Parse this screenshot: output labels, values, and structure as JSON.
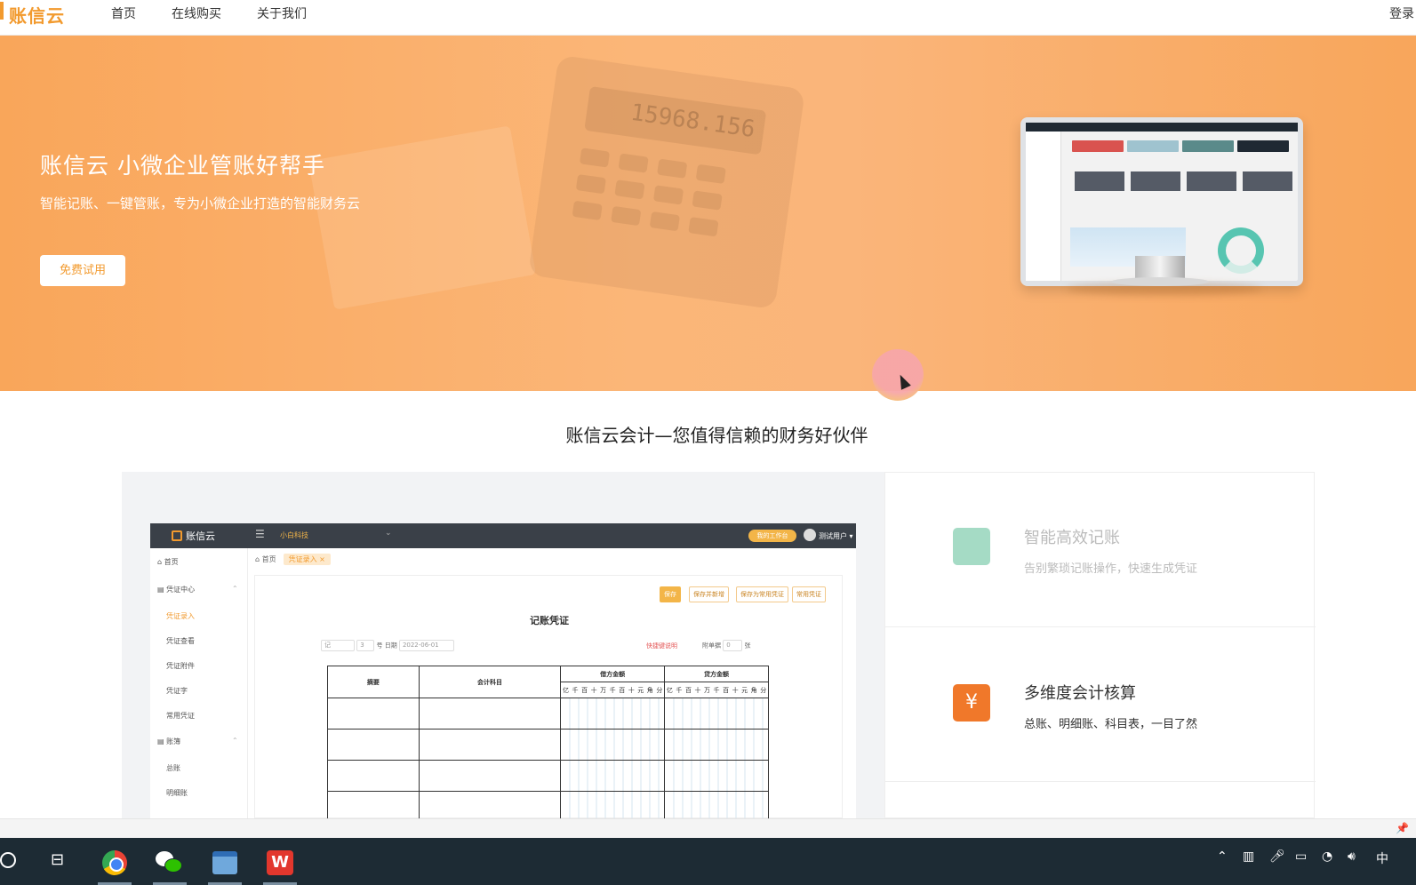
{
  "nav": {
    "logo": "账信云",
    "links": [
      "首页",
      "在线购买",
      "关于我们"
    ],
    "login": "登录"
  },
  "hero": {
    "title": "账信云 小微企业管账好帮手",
    "subtitle": "智能记账、一键管账，专为小微企业打造的智能财务云",
    "button": "免费试用",
    "calculator_display": "15968.156"
  },
  "section": {
    "title": "账信云会计—您值得信赖的财务好伙伴"
  },
  "features": [
    {
      "title": "智能高效记账",
      "desc": "告别繁琐记账操作，快速生成凭证",
      "icon": "document-icon",
      "color": "#a5dbc5",
      "muted": true
    },
    {
      "title": "多维度会计核算",
      "desc": "总账、明细账、科目表，一目了然",
      "icon": "yen-icon",
      "color": "#f0782a",
      "muted": false
    }
  ],
  "mockup": {
    "logo": "账信云",
    "company": "小白科技",
    "workbench": "我的工作台",
    "user": "测试用户",
    "breadcrumb_home": "首页",
    "breadcrumb_tab": "凭证录入 ×",
    "sidebar": [
      {
        "label": "首页",
        "active": false,
        "group": true
      },
      {
        "label": "凭证中心",
        "active": false,
        "group": true
      },
      {
        "label": "凭证录入",
        "active": true,
        "group": false
      },
      {
        "label": "凭证查看",
        "active": false,
        "group": false
      },
      {
        "label": "凭证附件",
        "active": false,
        "group": false
      },
      {
        "label": "凭证字",
        "active": false,
        "group": false
      },
      {
        "label": "常用凭证",
        "active": false,
        "group": false
      },
      {
        "label": "账簿",
        "active": false,
        "group": true
      },
      {
        "label": "总账",
        "active": false,
        "group": false
      },
      {
        "label": "明细账",
        "active": false,
        "group": false
      }
    ],
    "buttons": [
      "保存",
      "保存并新增",
      "保存为常用凭证",
      "常用凭证"
    ],
    "voucher_title": "记账凭证",
    "voucher_word": "记",
    "voucher_no": "3",
    "no_label": "号",
    "date_label": "日期",
    "date_value": "2022-06-01",
    "shortcut": "快捷键说明",
    "attachment_label": "附单据",
    "attachment_count": "0",
    "attachment_unit": "张",
    "table": {
      "col_summary": "摘要",
      "col_account": "会计科目",
      "col_debit": "借方金额",
      "col_credit": "贷方金额",
      "digits": [
        "亿",
        "千",
        "百",
        "十",
        "万",
        "千",
        "百",
        "十",
        "元",
        "角",
        "分"
      ]
    }
  },
  "taskbar": {
    "apps": [
      "chrome-icon",
      "wechat-icon",
      "file-explorer-icon",
      "wps-icon"
    ],
    "wps_letter": "W",
    "ime": "中"
  }
}
